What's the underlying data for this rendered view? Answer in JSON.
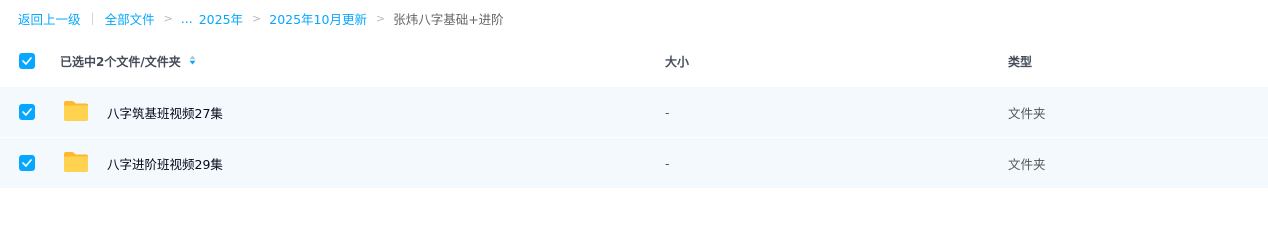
{
  "breadcrumb": {
    "back": "返回上一级",
    "items": [
      "全部文件",
      "...",
      "2025年",
      "2025年10月更新"
    ],
    "current": "张炜八字基础+进阶"
  },
  "table": {
    "header": {
      "selection_label": "已选中2个文件/文件夹",
      "size_label": "大小",
      "type_label": "类型"
    },
    "rows": [
      {
        "name": "八字筑基班视频27集",
        "size": "-",
        "type": "文件夹",
        "selected": true
      },
      {
        "name": "八字进阶班视频29集",
        "size": "-",
        "type": "文件夹",
        "selected": true
      }
    ]
  },
  "colors": {
    "accent": "#06a7ff",
    "row_selected_bg": "#f3f9fd",
    "folder": "#ffc93b"
  },
  "icons": {
    "checkbox": "check-icon",
    "sort": "sort-icon",
    "folder": "folder-icon",
    "breadcrumb_separator": "chevron-right-icon"
  }
}
